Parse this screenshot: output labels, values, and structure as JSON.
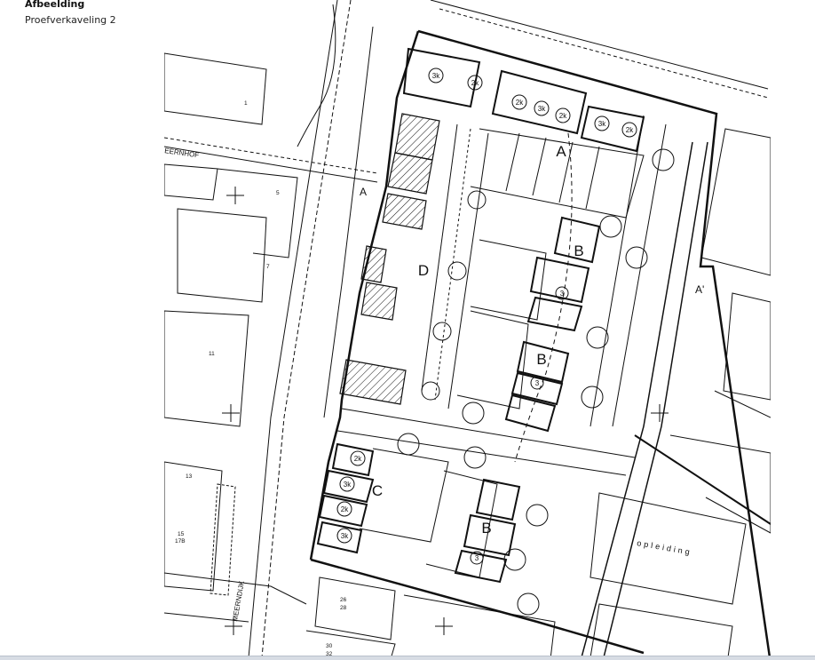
{
  "panel": {
    "title": "Afbeelding",
    "subtitle": "Proefverkaveling 2"
  },
  "map": {
    "plot_labels": {
      "a": "A",
      "b1": "B",
      "b2": "B",
      "b3": "B",
      "c": "C",
      "d": "D"
    },
    "section_markers": {
      "a_left": "A",
      "a_right": "A'"
    },
    "street_names": {
      "meernhof": "EERNHOF",
      "meerndijk": "MEERNDIJK"
    },
    "building_label": "opleiding",
    "unit_labels": {
      "top_3k": "3k",
      "top_2k": "2k",
      "row_2k": "2k",
      "row_3k": "3k",
      "row_2k_b": "2k",
      "right_3k": "3k",
      "right_2k": "2k",
      "b1_3": "3",
      "b2_3": "3",
      "b3_3": "3",
      "c1_2k": "2k",
      "c2_3k": "3k",
      "c3_2k": "2k",
      "c4_3k": "3k"
    },
    "house_numbers": {
      "n1": "1",
      "n5": "5",
      "n7": "7",
      "n11": "11",
      "n13": "13",
      "n15": "15",
      "n17b": "17B",
      "n26": "26",
      "n28": "28",
      "n30": "30",
      "n32": "32"
    }
  }
}
